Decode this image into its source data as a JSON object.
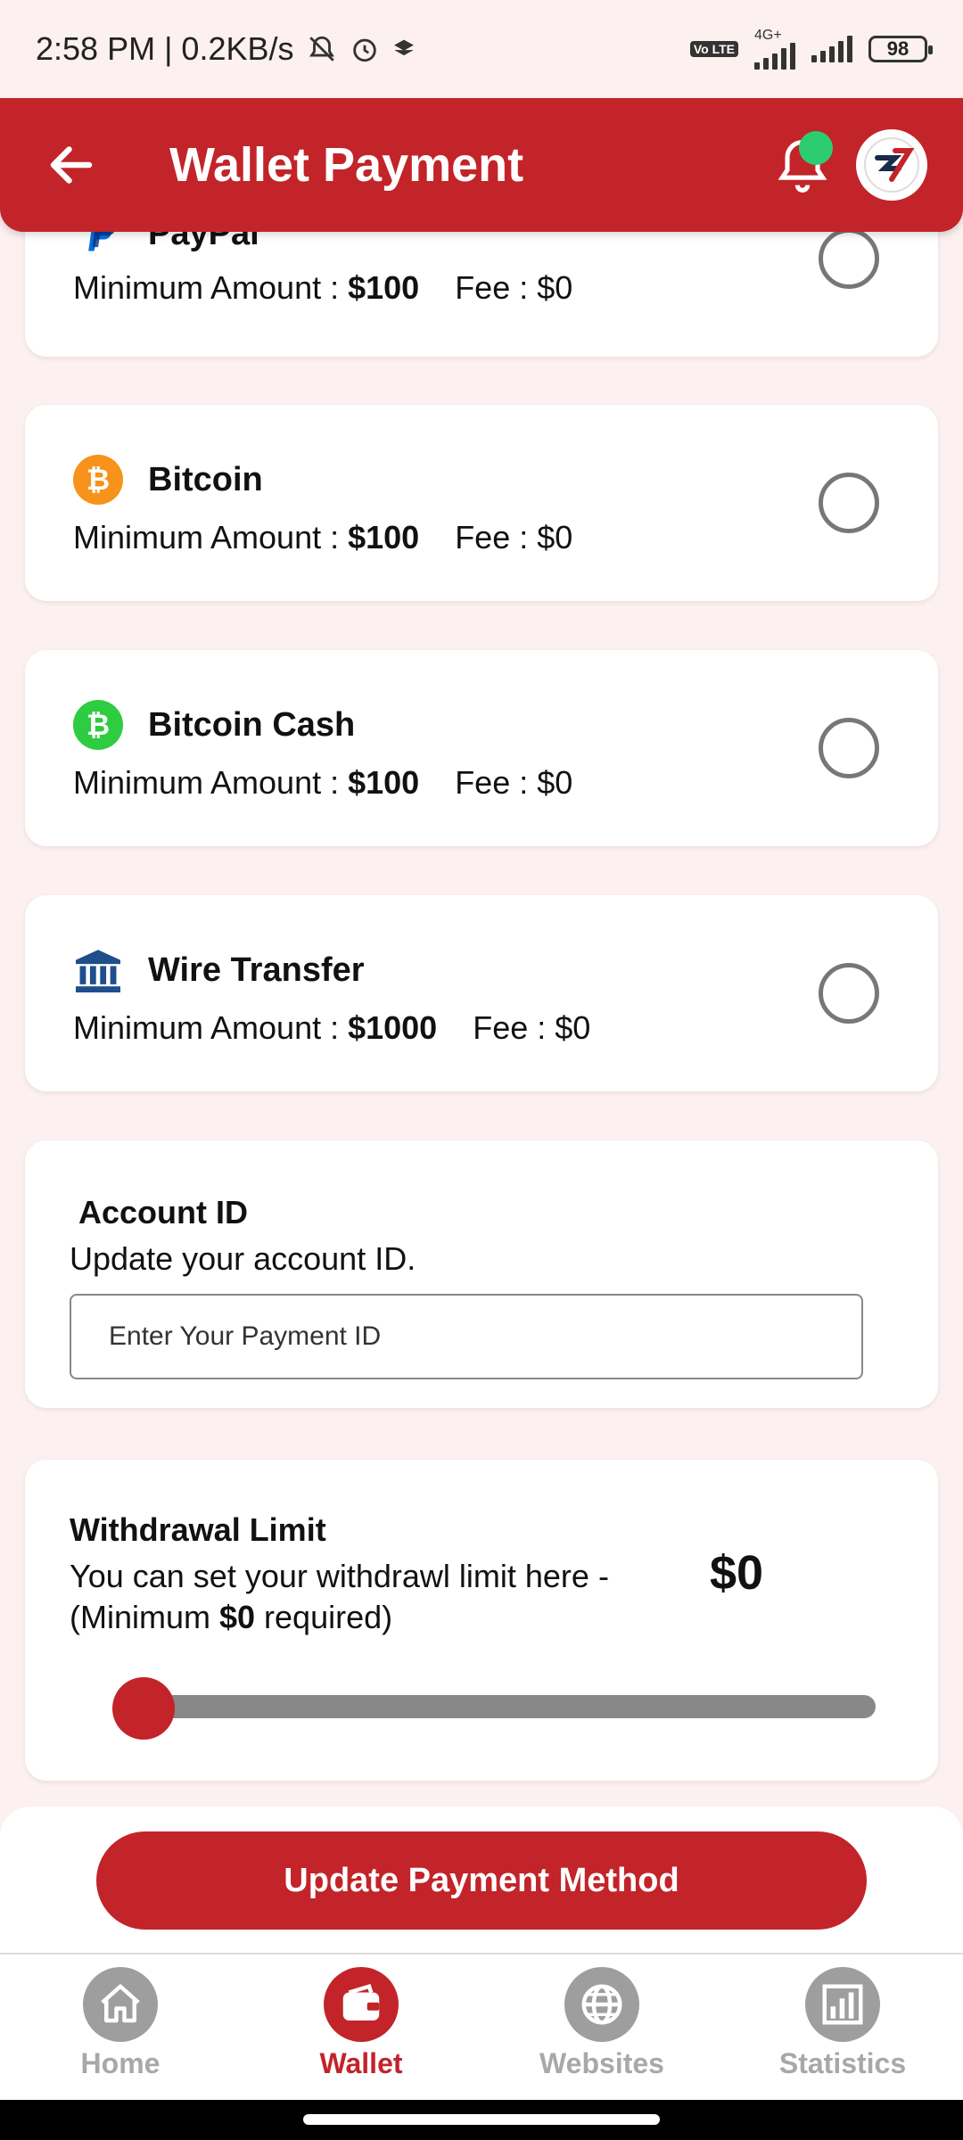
{
  "status_bar": {
    "time_speed": "2:58 PM | 0.2KB/s",
    "lte_badge": "Vo LTE",
    "network": "4G+",
    "battery": "98"
  },
  "app_bar": {
    "title": "Wallet Payment",
    "logo_text": "S7"
  },
  "payment_methods": [
    {
      "name": "PayPal",
      "min_label": "Minimum Amount : ",
      "min_value": "$100",
      "fee": "Fee : $0",
      "icon": "paypal-icon",
      "selected": false
    },
    {
      "name": "Bitcoin",
      "min_label": "Minimum Amount : ",
      "min_value": "$100",
      "fee": "Fee : $0",
      "icon": "bitcoin-icon",
      "icon_color": "#f7931a",
      "selected": false
    },
    {
      "name": "Bitcoin Cash",
      "min_label": "Minimum Amount : ",
      "min_value": "$100",
      "fee": "Fee : $0",
      "icon": "bitcoin-cash-icon",
      "icon_color": "#2ecc40",
      "selected": false
    },
    {
      "name": "Wire Transfer",
      "min_label": "Minimum Amount : ",
      "min_value": "$1000",
      "fee": "Fee : $0",
      "icon": "bank-icon",
      "selected": false
    }
  ],
  "account": {
    "title": "Account ID",
    "subtitle": "Update your  account ID.",
    "placeholder": "Enter Your Payment ID",
    "value": ""
  },
  "withdrawal": {
    "title": "Withdrawal Limit",
    "desc_line1": "You can set your withdrawl limit here -",
    "desc_prefix": "(Minimum ",
    "desc_min": "$0",
    "desc_suffix": " required)",
    "amount": "$0",
    "slider_value": 0
  },
  "update_button": "Update Payment Method",
  "nav": [
    {
      "label": "Home",
      "icon": "home-icon",
      "active": false
    },
    {
      "label": "Wallet",
      "icon": "wallet-icon",
      "active": true
    },
    {
      "label": "Websites",
      "icon": "globe-icon",
      "active": false
    },
    {
      "label": "Statistics",
      "icon": "bar-chart-icon",
      "active": false
    }
  ],
  "colors": {
    "primary": "#c22429",
    "background": "#fcf0f0",
    "indicator": "#2ecc71"
  }
}
